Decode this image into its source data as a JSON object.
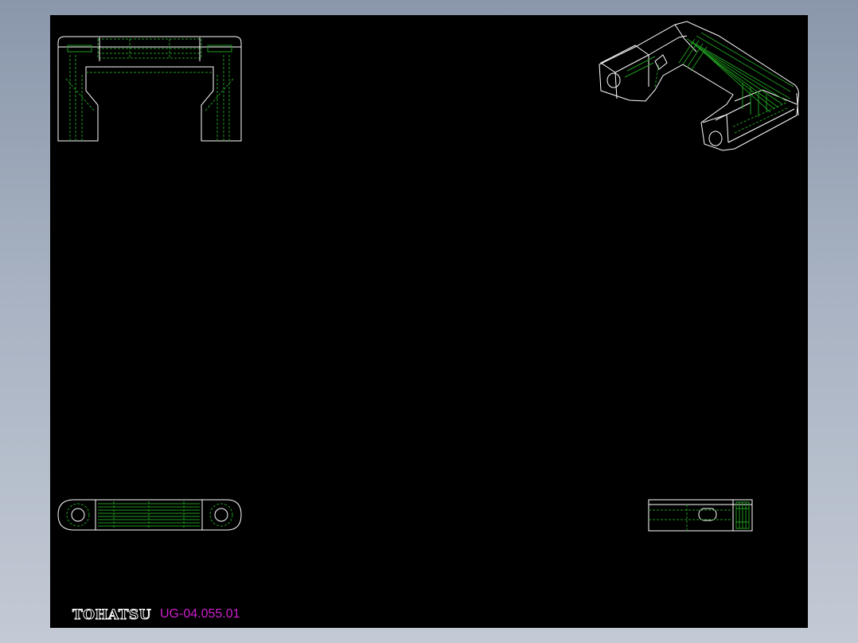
{
  "title_block": {
    "brand": "TOHATSU",
    "drawing_number": "UG-04.055.01"
  },
  "colors": {
    "background_gradient_top": "#8a97ab",
    "sheet": "#000000",
    "outline": "#ffffff",
    "hidden_lines": "#1f9a1f",
    "drawing_number_text": "#d01fd0"
  },
  "views": [
    "front-view",
    "isometric-view",
    "top-view",
    "side-view"
  ]
}
